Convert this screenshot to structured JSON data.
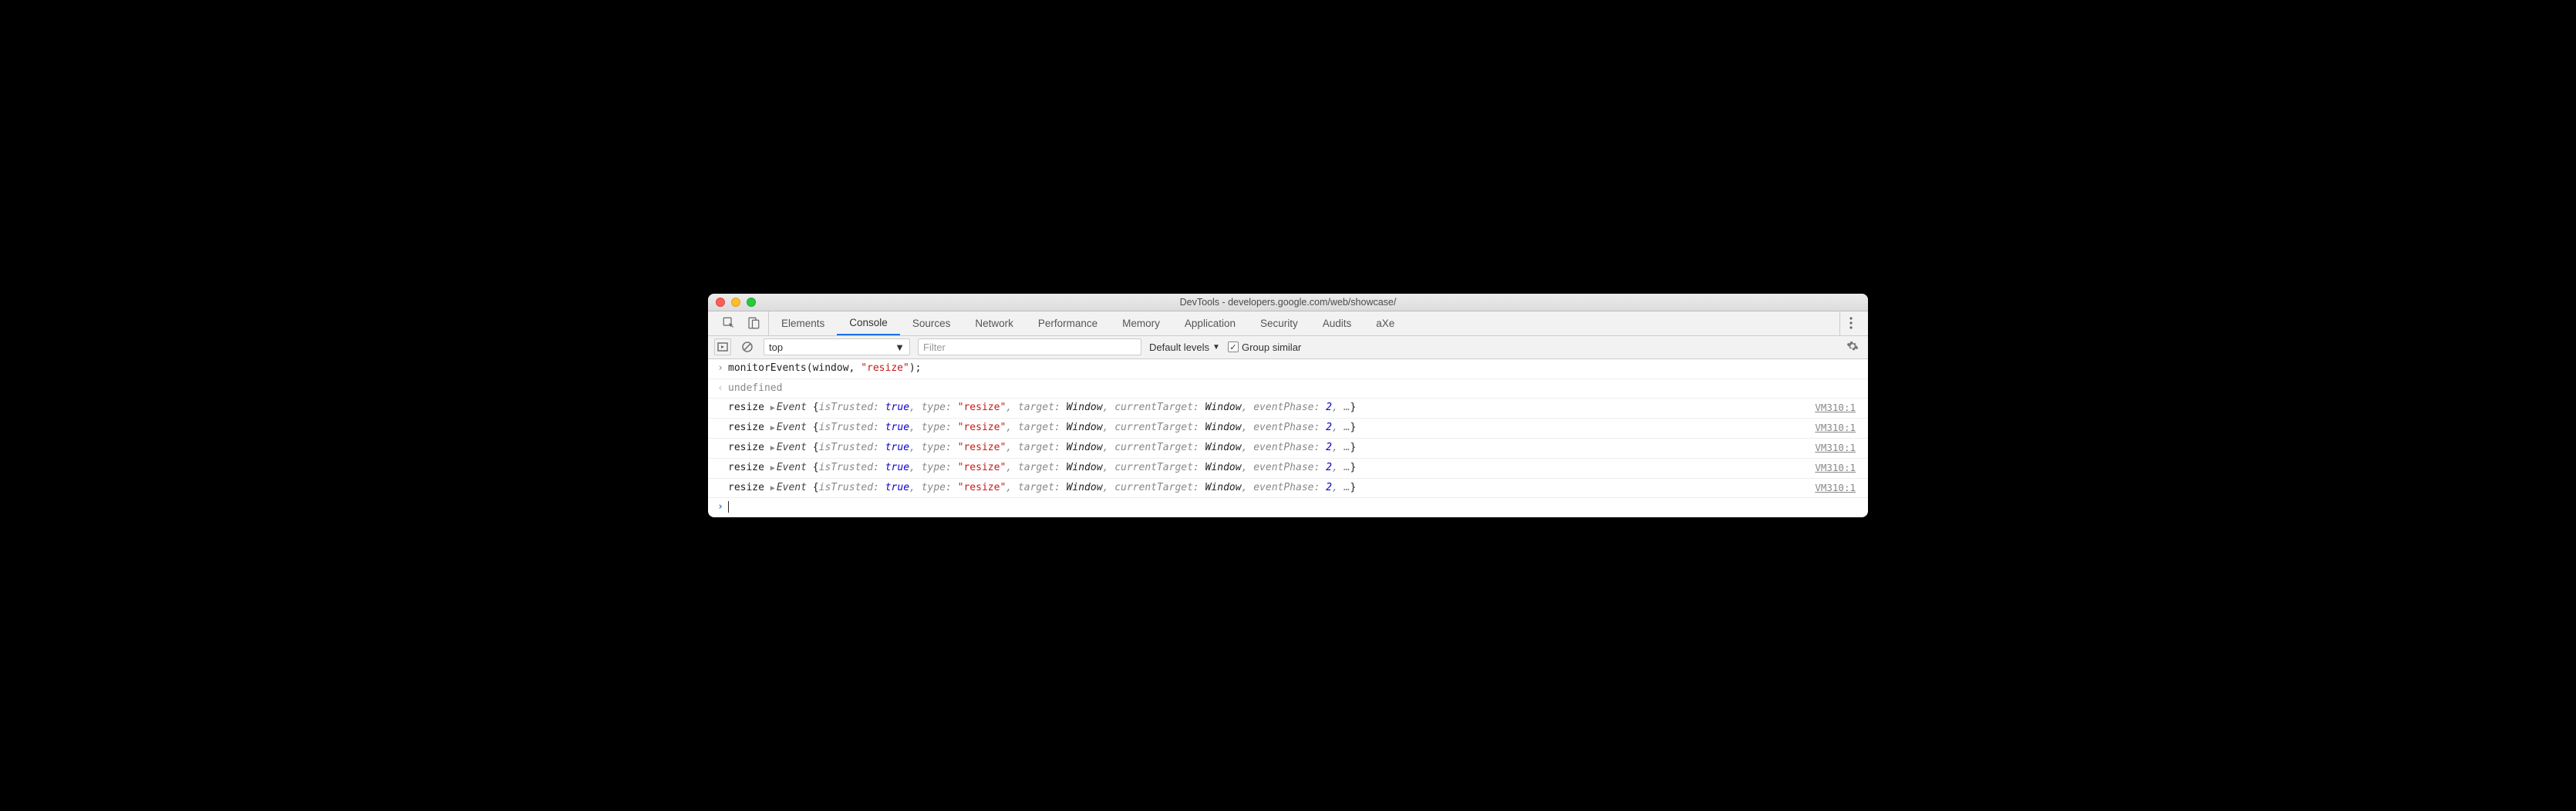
{
  "window": {
    "title": "DevTools - developers.google.com/web/showcase/"
  },
  "tabs": {
    "items": [
      "Elements",
      "Console",
      "Sources",
      "Network",
      "Performance",
      "Memory",
      "Application",
      "Security",
      "Audits",
      "aXe"
    ],
    "active": "Console"
  },
  "toolbar": {
    "context": "top",
    "filter_placeholder": "Filter",
    "levels_label": "Default levels",
    "group_similar": "Group similar",
    "group_checked": true
  },
  "console": {
    "input": "monitorEvents(window, \"resize\");",
    "input_parts": {
      "fn": "monitorEvents",
      "open": "(",
      "arg1": "window",
      "sep": ", ",
      "quote": "\"",
      "str": "resize",
      "close": ");"
    },
    "result": "undefined",
    "events": [
      {
        "label": "resize",
        "objName": "Event",
        "props": {
          "isTrusted": "true",
          "type": "\"resize\"",
          "target": "Window",
          "currentTarget": "Window",
          "eventPhase": "2"
        },
        "trail": ", …",
        "source": "VM310:1"
      },
      {
        "label": "resize",
        "objName": "Event",
        "props": {
          "isTrusted": "true",
          "type": "\"resize\"",
          "target": "Window",
          "currentTarget": "Window",
          "eventPhase": "2"
        },
        "trail": ", …",
        "source": "VM310:1"
      },
      {
        "label": "resize",
        "objName": "Event",
        "props": {
          "isTrusted": "true",
          "type": "\"resize\"",
          "target": "Window",
          "currentTarget": "Window",
          "eventPhase": "2"
        },
        "trail": ", …",
        "source": "VM310:1"
      },
      {
        "label": "resize",
        "objName": "Event",
        "props": {
          "isTrusted": "true",
          "type": "\"resize\"",
          "target": "Window",
          "currentTarget": "Window",
          "eventPhase": "2"
        },
        "trail": ", …",
        "source": "VM310:1"
      },
      {
        "label": "resize",
        "objName": "Event",
        "props": {
          "isTrusted": "true",
          "type": "\"resize\"",
          "target": "Window",
          "currentTarget": "Window",
          "eventPhase": "2"
        },
        "trail": ", …",
        "source": "VM310:1"
      }
    ]
  }
}
